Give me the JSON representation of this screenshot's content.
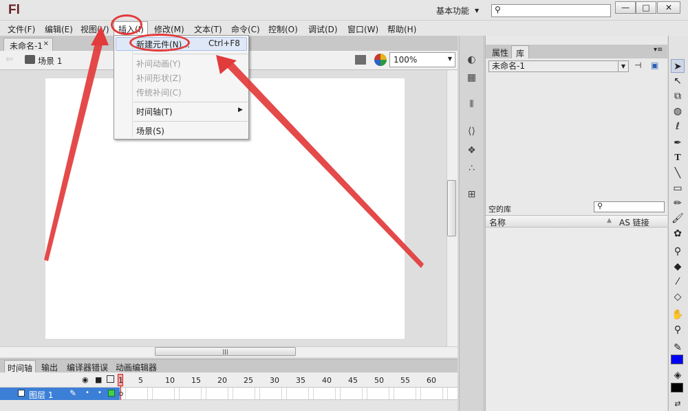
{
  "app": {
    "logo": "Fl",
    "workspace": "基本功能",
    "window_buttons": [
      "—",
      "□",
      "✕"
    ]
  },
  "menubar": {
    "items": [
      "文件(F)",
      "编辑(E)",
      "视图(V)",
      "插入(I)",
      "修改(M)",
      "文本(T)",
      "命令(C)",
      "控制(O)",
      "调试(D)",
      "窗口(W)",
      "帮助(H)"
    ]
  },
  "insert_menu": {
    "new_symbol": "新建元件(N)...",
    "new_symbol_shortcut": "Ctrl+F8",
    "motion_tween": "补间动画(Y)",
    "shape_tween": "补间形状(Z)",
    "classic_tween": "传统补间(C)",
    "timeline": "时间轴(T)",
    "scene": "场景(S)"
  },
  "document": {
    "tab_title": "未命名-1",
    "close": "×",
    "scene": "场景 1",
    "zoom": "100%"
  },
  "timeline": {
    "tabs": [
      "时间轴",
      "输出",
      "编译器错误",
      "动画编辑器"
    ],
    "frame_numbers": [
      "1",
      "5",
      "10",
      "15",
      "20",
      "25",
      "30",
      "35",
      "40",
      "45",
      "50",
      "55",
      "60"
    ],
    "layer_name": "图层 1"
  },
  "library": {
    "tabs": [
      "属性",
      "库"
    ],
    "document_select": "未命名-1",
    "empty_label": "空的库",
    "columns": [
      "名称",
      "AS 链接"
    ]
  },
  "colors": {
    "stroke": "#0000ff",
    "fill": "#000000",
    "annotation": "#e23b3b"
  }
}
